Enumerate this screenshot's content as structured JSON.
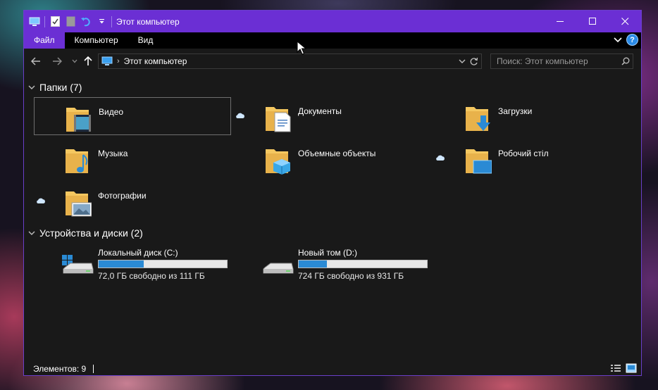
{
  "window": {
    "title": "Этот компьютер",
    "accent_color": "#6b2fd4",
    "controls": [
      "minimize-icon",
      "maximize-icon",
      "close-icon"
    ]
  },
  "quick_access": {
    "icons": [
      "computer-icon",
      "properties-icon",
      "new-folder-icon",
      "undo-icon",
      "customize-toolbar-icon"
    ]
  },
  "menu": {
    "items": [
      "Файл",
      "Компьютер",
      "Вид"
    ],
    "active": "Файл",
    "help_label": "?"
  },
  "address": {
    "crumb": "Этот компьютер",
    "icons": [
      "back-arrow-icon",
      "forward-arrow-icon",
      "recent-dropdown-icon",
      "up-arrow-icon",
      "computer-icon",
      "chevron-right-icon",
      "chevron-down-icon",
      "refresh-icon"
    ]
  },
  "search": {
    "placeholder": "Поиск: Этот компьютер",
    "value": ""
  },
  "folders_group": {
    "title": "Папки (7)",
    "items": [
      {
        "label": "Видео",
        "icon": "video-folder-icon",
        "selected": true
      },
      {
        "label": "Документы",
        "icon": "documents-folder-icon"
      },
      {
        "label": "Загрузки",
        "icon": "downloads-folder-icon"
      },
      {
        "label": "Музыка",
        "icon": "music-folder-icon"
      },
      {
        "label": "Объемные объекты",
        "icon": "3d-objects-folder-icon"
      },
      {
        "label": "Робочий стіл",
        "icon": "desktop-folder-icon"
      },
      {
        "label": "Фотографии",
        "icon": "pictures-folder-icon"
      }
    ]
  },
  "drives_group": {
    "title": "Устройства и диски (2)",
    "items": [
      {
        "label": "Локальный диск (C:)",
        "free": "72,0 ГБ свободно из 111 ГБ",
        "used_fraction": 0.35,
        "icon": "system-drive-icon"
      },
      {
        "label": "Новый том (D:)",
        "free": "724 ГБ свободно из 931 ГБ",
        "used_fraction": 0.22,
        "icon": "hard-drive-icon"
      }
    ]
  },
  "status": {
    "items_count": "Элементов: 9",
    "view_icons": [
      "details-view-icon",
      "large-icons-view-icon"
    ]
  }
}
